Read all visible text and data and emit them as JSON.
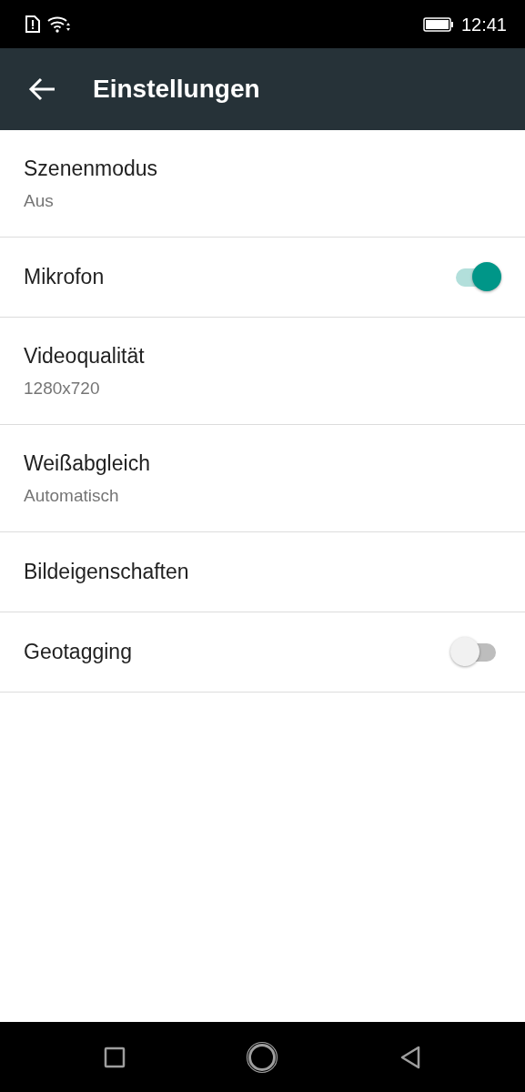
{
  "status_bar": {
    "time": "12:41"
  },
  "app_bar": {
    "title": "Einstellungen"
  },
  "settings": [
    {
      "kind": "value",
      "title": "Szenenmodus",
      "summary": "Aus"
    },
    {
      "kind": "switch",
      "title": "Mikrofon",
      "checked": true
    },
    {
      "kind": "value",
      "title": "Videoqualität",
      "summary": "1280x720"
    },
    {
      "kind": "value",
      "title": "Weißabgleich",
      "summary": "Automatisch"
    },
    {
      "kind": "plain",
      "title": "Bildeigenschaften"
    },
    {
      "kind": "switch",
      "title": "Geotagging",
      "checked": false
    }
  ]
}
